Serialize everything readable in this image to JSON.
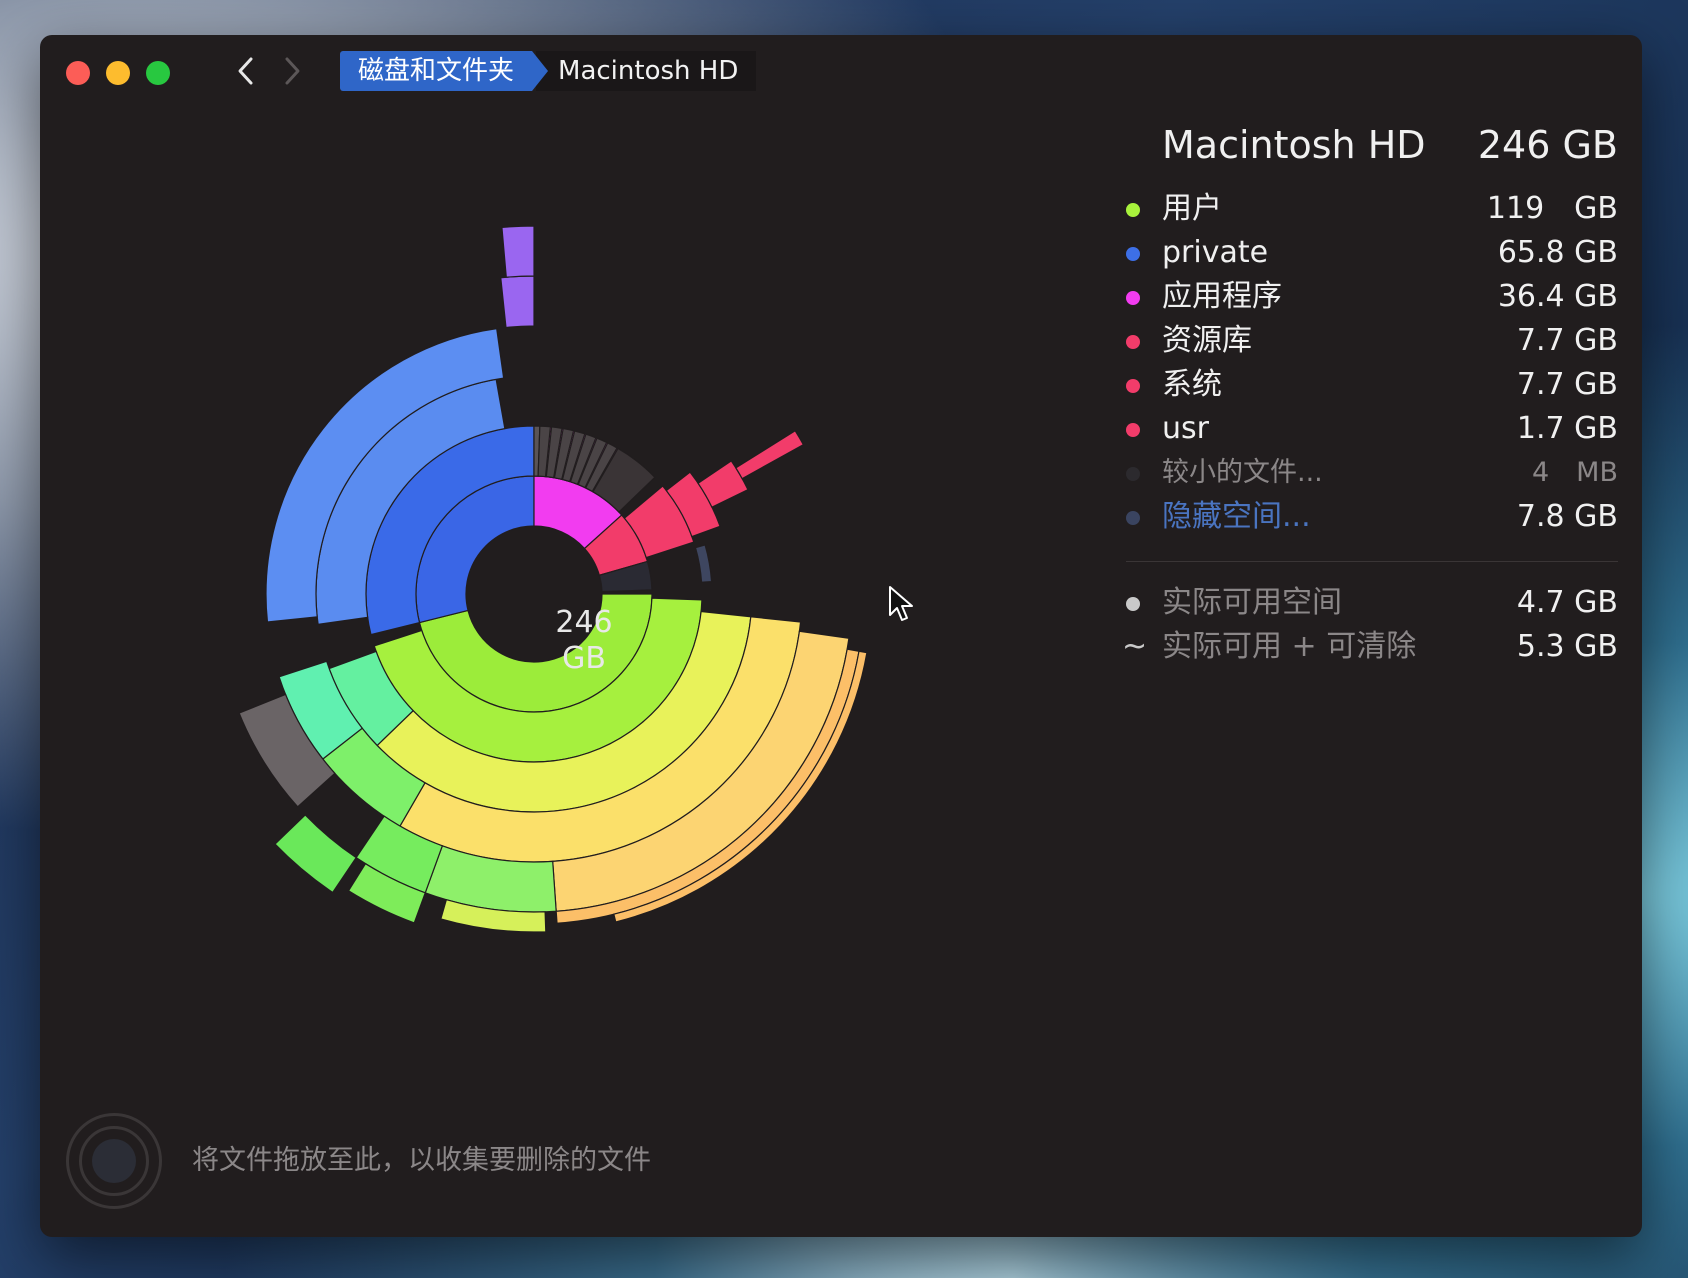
{
  "toolbar": {
    "breadcrumbs": [
      "磁盘和文件夹",
      "Macintosh HD"
    ]
  },
  "disk": {
    "name": "Macintosh HD",
    "total": "246 GB",
    "center_value": "246",
    "center_unit": "GB"
  },
  "legend": [
    {
      "label": "用户",
      "value": "119　GB",
      "color": "#a8f23c"
    },
    {
      "label": "private",
      "value": "65.8 GB",
      "color": "#3d6fe6"
    },
    {
      "label": "应用程序",
      "value": "36.4 GB",
      "color": "#f23cf0"
    },
    {
      "label": "资源库",
      "value": "7.7 GB",
      "color": "#f23c6a"
    },
    {
      "label": "系统",
      "value": "7.7 GB",
      "color": "#f23c6a"
    },
    {
      "label": "usr",
      "value": "1.7 GB",
      "color": "#f23c6a"
    },
    {
      "label": "较小的文件...",
      "value": "4　MB",
      "color": "#2c2a2e"
    },
    {
      "label": "隐藏空间...",
      "value": "7.8 GB",
      "color": "#3a4460"
    }
  ],
  "space": {
    "available_label": "实际可用空间",
    "available_value": "4.7 GB",
    "purgeable_label": "实际可用 + 可清除",
    "purgeable_value": "5.3 GB",
    "tilde": "~"
  },
  "drop": {
    "hint": "将文件拖放至此，以收集要删除的文件"
  },
  "colors": {
    "window_bg": "#211d1e",
    "accent": "#2f66c8"
  }
}
